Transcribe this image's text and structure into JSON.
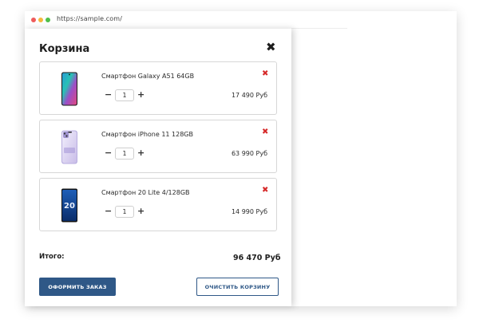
{
  "browser": {
    "url": "https://sample.com/",
    "dots": [
      "#ef5b5b",
      "#f5b83d",
      "#4fbf4a"
    ]
  },
  "cart": {
    "title": "Корзина",
    "close_glyph": "✖",
    "items": [
      {
        "name": "Смартфон Galaxy A51 64GB",
        "quantity": "1",
        "price": "17 490 Руб",
        "image": "galaxy-a51-phone-icon"
      },
      {
        "name": "Смартфон iPhone 11 128GB",
        "quantity": "1",
        "price": "63 990 Руб",
        "image": "iphone-11-phone-icon"
      },
      {
        "name": "Смартфон 20 Lite 4/128GB",
        "quantity": "1",
        "price": "14 990 Руб",
        "image": "honor-20-lite-phone-icon"
      }
    ],
    "minus_glyph": "−",
    "plus_glyph": "+",
    "remove_glyph": "✖",
    "total_label": "Итого:",
    "total_value": "96 470 Руб",
    "order_button": "ОФОРМИТЬ ЗАКАЗ",
    "clear_button": "ОЧИСТИТЬ КОРЗИНУ"
  },
  "colors": {
    "accent": "#2f5887",
    "remove": "#d62a2a"
  }
}
